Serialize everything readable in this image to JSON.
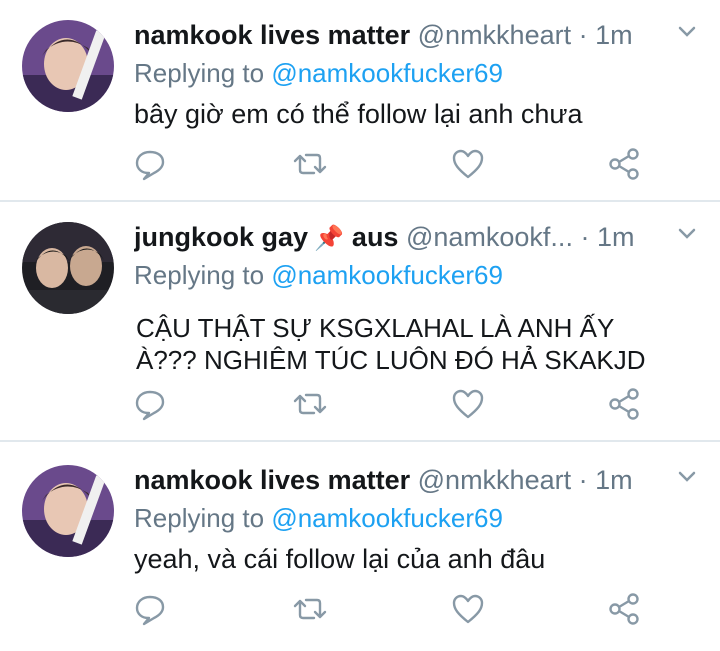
{
  "tweets": [
    {
      "name": "namkook lives matter",
      "handle": "@nmkkheart",
      "separator": "·",
      "time": "1m",
      "reply_prefix": "Replying to",
      "reply_mention": "@namkookfucker69",
      "text": "bây giờ em có thể follow lại anh chưa",
      "avatar_icon": "user-avatar-purple"
    },
    {
      "name": "jungkook gay",
      "pin_icon": "📌",
      "name_suffix": "aus",
      "handle": "@namkookf...",
      "separator": "·",
      "time": "1m",
      "reply_prefix": "Replying to",
      "reply_mention": "@namkookfucker69",
      "text_line1": "CẬU THẬT SỰ KSGXLAHAL LÀ ANH ẤY",
      "text_line2": "À??? NGHIÊM TÚC LUÔN ĐÓ HẢ SKAKJD",
      "avatar_icon": "user-avatar-dark"
    },
    {
      "name": "namkook lives matter",
      "handle": "@nmkkheart",
      "separator": "·",
      "time": "1m",
      "reply_prefix": "Replying to",
      "reply_mention": "@namkookfucker69",
      "text": "yeah, và cái follow lại của anh đâu",
      "avatar_icon": "user-avatar-purple"
    }
  ],
  "colors": {
    "text": "#14171a",
    "secondary": "#657786",
    "link": "#1da1f2",
    "divider": "#e1e8ed"
  }
}
